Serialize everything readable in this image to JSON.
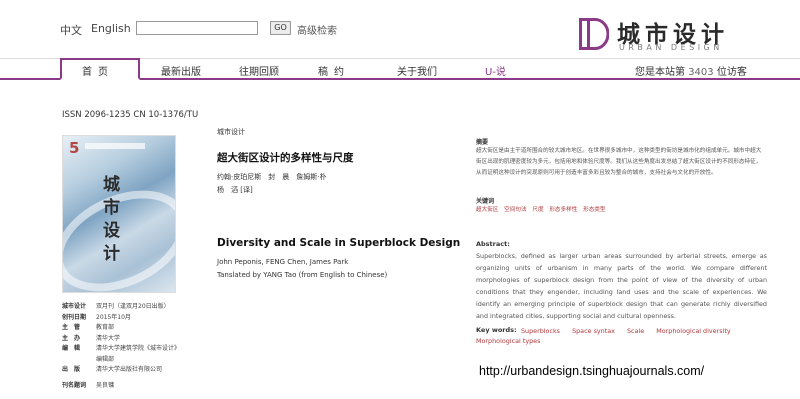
{
  "header": {
    "lang_cn": "中文",
    "lang_en": "English",
    "search_value": "",
    "go_label": "GO",
    "advanced_search": "高级检索"
  },
  "logo": {
    "cn": "城市设计",
    "en": "URBAN DESIGN",
    "color": "#8a3a87"
  },
  "nav": {
    "items": [
      "首页",
      "最新出版",
      "往期回顾",
      "稿约",
      "关于我们",
      "U-说"
    ],
    "active": "首页",
    "visitor_prefix": "您是本站第",
    "visitor_count": "3403",
    "visitor_suffix": "位访客"
  },
  "journal": {
    "issn": "ISSN 2096-1235 CN 10-1376/TU",
    "cover_issue": "5",
    "cover_title": "城市设计",
    "info": [
      {
        "key": "城市设计",
        "value": "双月刊（逢双月20日出版）"
      },
      {
        "key": "创刊日期",
        "value": "2015年10月"
      },
      {
        "key": "主　管",
        "value": "教育部"
      },
      {
        "key": "主　办",
        "value": "清华大学"
      },
      {
        "key": "编　辑",
        "value": "清华大学建筑学院《城市设计》"
      },
      {
        "key": "",
        "value": "编辑部"
      },
      {
        "key": "出　版",
        "value": "清华大学出版社有限公司"
      },
      {
        "key": "",
        "value": ""
      },
      {
        "key": "刊名题词",
        "value": "吴良镛"
      }
    ]
  },
  "article": {
    "category": "城市设计",
    "title_cn": "超大街区设计的多样性与尺度",
    "authors_cn": "约翰·皮珀尼斯　封　晨　詹姆斯·朴",
    "translator_cn": "杨　滔 [译]",
    "title_en": "Diversity and Scale in Superblock Design",
    "authors_en": "John Peponis, FENG Chen, James Park",
    "translator_en": "Tanslated by YANG Tao (from English to Chinese)"
  },
  "abstract_cn": {
    "label": "摘要",
    "text": "超大街区是由主干道所围合的较大城市地区。在世界很多城市中，这种类型的街坊是城市化的组成单元。城市中超大街区出现的肌理密度较为多元，包括用地和体验尺度等。我们从这些角度出发总结了超大街区设计的不同形态特征，从而证明这种设计的突现原则可用于创造丰富多彩且较为整合的城市，支持社会与文化的开放性。",
    "keywords_label": "关键词",
    "keywords": [
      "超大街区",
      "空间句法",
      "尺度",
      "形态多样性",
      "形态类型"
    ]
  },
  "abstract_en": {
    "label": "Abstract:",
    "text": "Superblocks, defined as larger urban areas surrounded by arterial streets, emerge as organizing units of urbanism in many parts of the world. We compare different morphologies of superblock design from the point of view of the diversity of urban conditions that they engender, including land uses and the scale of experiences. We identify an emerging principle of superblock design that can generate richly diversified and integrated cities, supporting social and cultural openness.",
    "keywords_label": "Key words:",
    "keywords": [
      "Superblocks",
      "Space syntax",
      "Scale",
      "Morphological diversity"
    ],
    "keywords_wrap": "Morphological types"
  },
  "footer": {
    "url": "http://urbandesign.tsinghuajournals.com/"
  }
}
